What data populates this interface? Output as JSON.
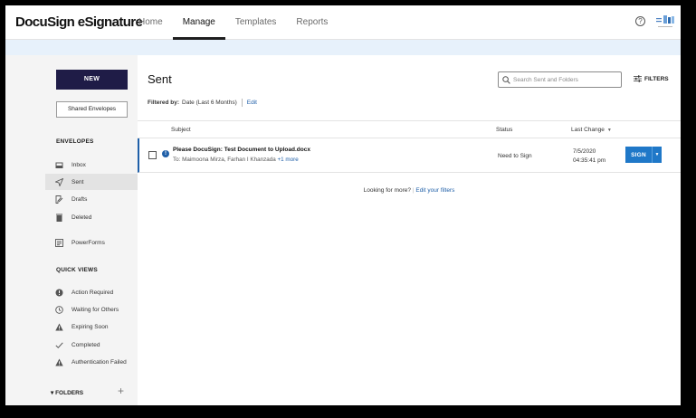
{
  "header": {
    "app_name": "DocuSign eSignature",
    "nav": [
      {
        "label": "Home",
        "active": false
      },
      {
        "label": "Manage",
        "active": true
      },
      {
        "label": "Templates",
        "active": false
      },
      {
        "label": "Reports",
        "active": false
      }
    ],
    "help_icon": "question-circle-icon",
    "help_glyph": "?",
    "corner_logo_icon": "company-logo-icon"
  },
  "sidebar": {
    "new_button": "NEW",
    "shared_button": "Shared Envelopes",
    "envelopes_heading": "ENVELOPES",
    "envelopes": [
      {
        "label": "Inbox",
        "icon": "inbox-icon",
        "active": false
      },
      {
        "label": "Sent",
        "icon": "send-icon",
        "active": true
      },
      {
        "label": "Drafts",
        "icon": "draft-icon",
        "active": false
      },
      {
        "label": "Deleted",
        "icon": "trash-icon",
        "active": false
      },
      {
        "label": "PowerForms",
        "icon": "powerforms-icon",
        "active": false
      }
    ],
    "quick_views_heading": "QUICK VIEWS",
    "quick_views": [
      {
        "label": "Action Required",
        "icon": "alert-circle-icon"
      },
      {
        "label": "Waiting for Others",
        "icon": "clock-icon"
      },
      {
        "label": "Expiring Soon",
        "icon": "warning-triangle-icon"
      },
      {
        "label": "Completed",
        "icon": "checkmark-icon"
      },
      {
        "label": "Authentication Failed",
        "icon": "warning-triangle-icon"
      }
    ],
    "folders_label": "▾ FOLDERS",
    "folders_add": "+"
  },
  "main": {
    "title": "Sent",
    "search_placeholder": "Search Sent and Folders",
    "filters_label": "FILTERS",
    "filter_prefix": "Filtered by:",
    "filter_value": "Date (Last 6 Months)",
    "filter_edit": "Edit",
    "columns": {
      "subject": "Subject",
      "status": "Status",
      "last_change": "Last Change",
      "sort_glyph": "▼"
    },
    "rows": [
      {
        "info_glyph": "!",
        "subject": "Please DocuSign: Test Document to Upload.docx",
        "recipients": "To: Maimoona Mirza, Farhan I Khanzada",
        "more": "+1 more",
        "status": "Need to Sign",
        "date": "7/5/2020",
        "time": "04:35:41 pm",
        "action": "SIGN",
        "action_caret": "▼"
      }
    ],
    "more_prompt": "Looking for more?",
    "more_link": "Edit your filters"
  },
  "colors": {
    "brand_dark": "#1f1c47",
    "link_blue": "#1f5fa8",
    "button_blue": "#1f78c8",
    "banner": "#e7f1fb"
  }
}
